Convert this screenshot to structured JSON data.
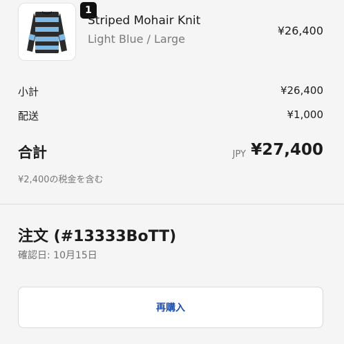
{
  "item": {
    "name": "Striped Mohair Knit",
    "variant": "Light Blue / Large",
    "price": "¥26,400",
    "quantity": "1",
    "image_icon": "striped-sweater-icon",
    "stripe_colors": [
      "#7fb8e2",
      "#2b2b2b"
    ]
  },
  "summary": {
    "subtotal_label": "小計",
    "subtotal_value": "¥26,400",
    "shipping_label": "配送",
    "shipping_value": "¥1,000",
    "total_label": "合計",
    "total_currency": "JPY",
    "total_value": "¥27,400",
    "tax_note": "¥2,400の税金を含む"
  },
  "order": {
    "title": "注文 (#13333BoTT)",
    "confirmed_date": "確認日: 10月15日",
    "reorder_label": "再購入"
  },
  "colors": {
    "background": "#f5f5f5",
    "accent": "#1f4fa8"
  }
}
